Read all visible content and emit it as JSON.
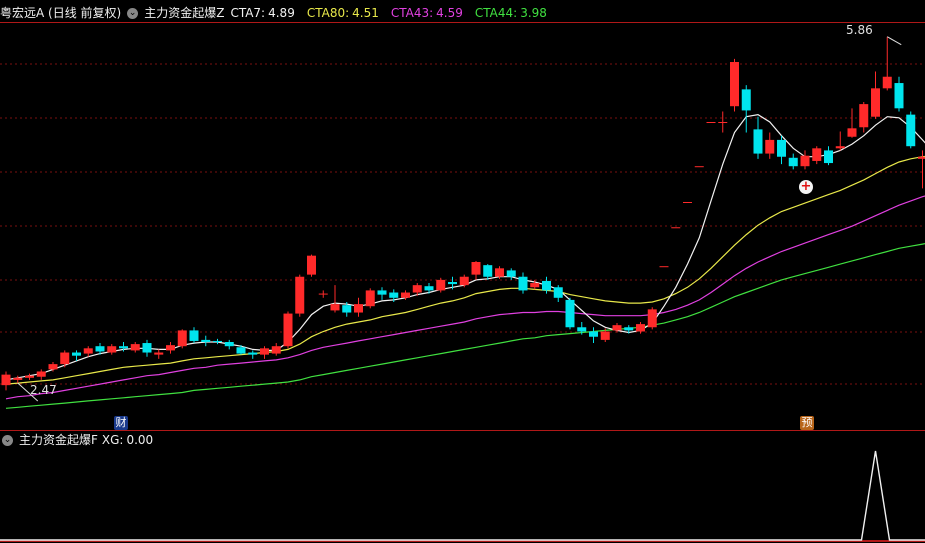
{
  "header": {
    "title": "粤宏远A (日线 前复权)",
    "indicator_name": "主力资金起爆Z",
    "ind1": {
      "label": "CTA7:",
      "value": "4.89",
      "color": "#f2f2f2"
    },
    "ind2": {
      "label": "CTA80:",
      "value": "4.51",
      "color": "#e8e84a"
    },
    "ind3": {
      "label": "CTA43:",
      "value": "4.59",
      "color": "#e040e0"
    },
    "ind4": {
      "label": "CTA44:",
      "value": "3.98",
      "color": "#40e040"
    }
  },
  "sub_header": {
    "indicator_name": "主力资金起爆F",
    "xg_label": "XG:",
    "xg_value": "0.00"
  },
  "markers": {
    "high_price": "5.86",
    "low_price": "2.47",
    "finance_badge": "财",
    "forecast_badge": "预"
  },
  "colors": {
    "up": "#ff2a2a",
    "down": "#00e5ee",
    "grid": "#7a1010",
    "separator": "#b01818"
  },
  "chart_data": {
    "type": "candlestick",
    "y_range": [
      2.2,
      6.0
    ],
    "candles": [
      [
        2.55,
        2.65,
        2.68,
        2.5
      ],
      [
        2.6,
        2.62,
        2.64,
        2.57
      ],
      [
        2.62,
        2.64,
        2.66,
        2.6
      ],
      [
        2.63,
        2.68,
        2.7,
        2.6
      ],
      [
        2.7,
        2.75,
        2.77,
        2.68
      ],
      [
        2.75,
        2.86,
        2.88,
        2.72
      ],
      [
        2.86,
        2.83,
        2.88,
        2.78
      ],
      [
        2.85,
        2.9,
        2.92,
        2.82
      ],
      [
        2.92,
        2.87,
        2.95,
        2.84
      ],
      [
        2.86,
        2.92,
        2.94,
        2.84
      ],
      [
        2.92,
        2.9,
        2.96,
        2.87
      ],
      [
        2.88,
        2.94,
        2.96,
        2.86
      ],
      [
        2.95,
        2.86,
        2.98,
        2.82
      ],
      [
        2.84,
        2.86,
        2.89,
        2.8
      ],
      [
        2.88,
        2.93,
        2.96,
        2.85
      ],
      [
        2.92,
        3.07,
        3.08,
        2.9
      ],
      [
        3.07,
        2.97,
        3.1,
        2.95
      ],
      [
        2.98,
        2.96,
        3.02,
        2.92
      ],
      [
        2.97,
        2.96,
        2.99,
        2.94
      ],
      [
        2.96,
        2.92,
        2.98,
        2.89
      ],
      [
        2.91,
        2.85,
        2.93,
        2.84
      ],
      [
        2.86,
        2.84,
        2.88,
        2.8
      ],
      [
        2.84,
        2.9,
        2.92,
        2.8
      ],
      [
        2.85,
        2.92,
        2.95,
        2.83
      ],
      [
        2.92,
        3.23,
        3.25,
        2.9
      ],
      [
        3.23,
        3.58,
        3.6,
        3.2
      ],
      [
        3.6,
        3.78,
        3.79,
        3.58
      ],
      [
        3.42,
        3.42,
        3.45,
        3.38
      ],
      [
        3.26,
        3.32,
        3.5,
        3.24
      ],
      [
        3.31,
        3.24,
        3.34,
        3.2
      ],
      [
        3.24,
        3.32,
        3.38,
        3.2
      ],
      [
        3.3,
        3.45,
        3.47,
        3.28
      ],
      [
        3.45,
        3.41,
        3.48,
        3.36
      ],
      [
        3.43,
        3.38,
        3.46,
        3.34
      ],
      [
        3.38,
        3.43,
        3.45,
        3.36
      ],
      [
        3.43,
        3.5,
        3.52,
        3.4
      ],
      [
        3.49,
        3.45,
        3.52,
        3.42
      ],
      [
        3.45,
        3.55,
        3.57,
        3.43
      ],
      [
        3.53,
        3.51,
        3.58,
        3.46
      ],
      [
        3.5,
        3.58,
        3.6,
        3.48
      ],
      [
        3.6,
        3.72,
        3.73,
        3.55
      ],
      [
        3.69,
        3.58,
        3.7,
        3.55
      ],
      [
        3.58,
        3.66,
        3.68,
        3.56
      ],
      [
        3.64,
        3.58,
        3.66,
        3.55
      ],
      [
        3.58,
        3.45,
        3.62,
        3.42
      ],
      [
        3.48,
        3.52,
        3.55,
        3.46
      ],
      [
        3.54,
        3.45,
        3.58,
        3.42
      ],
      [
        3.48,
        3.38,
        3.5,
        3.34
      ],
      [
        3.36,
        3.1,
        3.38,
        3.08
      ],
      [
        3.1,
        3.06,
        3.15,
        3.03
      ],
      [
        3.06,
        3.01,
        3.1,
        2.95
      ],
      [
        2.98,
        3.06,
        3.09,
        2.96
      ],
      [
        3.07,
        3.12,
        3.14,
        3.05
      ],
      [
        3.1,
        3.07,
        3.12,
        3.04
      ],
      [
        3.06,
        3.13,
        3.15,
        3.04
      ],
      [
        3.1,
        3.27,
        3.29,
        3.08
      ],
      [
        3.68,
        3.68,
        3.68,
        3.68
      ],
      [
        4.05,
        4.05,
        4.05,
        4.05
      ],
      [
        4.29,
        4.29,
        4.29,
        4.29
      ],
      [
        4.63,
        4.63,
        4.63,
        4.63
      ],
      [
        5.05,
        5.05,
        5.05,
        5.05
      ],
      [
        5.05,
        5.05,
        5.15,
        4.95
      ],
      [
        5.2,
        5.62,
        5.65,
        5.15
      ],
      [
        5.36,
        5.16,
        5.4,
        4.95
      ],
      [
        4.98,
        4.75,
        5.1,
        4.7
      ],
      [
        4.75,
        4.88,
        4.95,
        4.7
      ],
      [
        4.88,
        4.72,
        4.92,
        4.65
      ],
      [
        4.71,
        4.63,
        4.75,
        4.6
      ],
      [
        4.63,
        4.73,
        4.78,
        4.6
      ],
      [
        4.68,
        4.8,
        4.82,
        4.65
      ],
      [
        4.78,
        4.66,
        4.82,
        4.64
      ],
      [
        4.8,
        4.82,
        4.96,
        4.78
      ],
      [
        4.91,
        4.99,
        5.18,
        4.9
      ],
      [
        5.0,
        5.22,
        5.24,
        4.95
      ],
      [
        5.1,
        5.37,
        5.53,
        5.08
      ],
      [
        5.37,
        5.48,
        5.86,
        5.35
      ],
      [
        5.42,
        5.18,
        5.48,
        5.15
      ],
      [
        5.12,
        4.82,
        5.15,
        4.8
      ],
      [
        4.7,
        4.72,
        4.78,
        4.42
      ],
      [
        4.72,
        4.61,
        4.74,
        4.52
      ],
      [
        4.63,
        4.67,
        4.7,
        4.58
      ],
      [
        4.68,
        4.63,
        4.72,
        4.58
      ],
      [
        4.62,
        4.6,
        4.65,
        4.55
      ],
      [
        4.6,
        4.52,
        4.62,
        4.48
      ],
      [
        4.5,
        4.46,
        4.52,
        4.42
      ]
    ],
    "cta7": [
      2.6,
      2.62,
      2.64,
      2.66,
      2.7,
      2.74,
      2.78,
      2.82,
      2.85,
      2.87,
      2.89,
      2.9,
      2.9,
      2.89,
      2.89,
      2.93,
      2.95,
      2.96,
      2.96,
      2.94,
      2.92,
      2.89,
      2.88,
      2.88,
      2.96,
      3.08,
      3.22,
      3.3,
      3.33,
      3.32,
      3.3,
      3.32,
      3.35,
      3.36,
      3.38,
      3.41,
      3.43,
      3.46,
      3.48,
      3.5,
      3.55,
      3.56,
      3.58,
      3.58,
      3.55,
      3.53,
      3.5,
      3.46,
      3.36,
      3.26,
      3.16,
      3.1,
      3.07,
      3.05,
      3.07,
      3.14,
      3.3,
      3.48,
      3.7,
      3.95,
      4.3,
      4.65,
      4.95,
      5.1,
      5.12,
      5.05,
      4.92,
      4.8,
      4.72,
      4.72,
      4.74,
      4.78,
      4.84,
      4.92,
      5.02,
      5.1,
      5.09,
      5.0,
      4.88,
      4.76,
      4.68,
      4.63,
      4.6,
      4.56,
      4.5
    ],
    "cta80": [
      2.56,
      2.57,
      2.58,
      2.59,
      2.6,
      2.62,
      2.64,
      2.66,
      2.68,
      2.7,
      2.72,
      2.73,
      2.74,
      2.75,
      2.76,
      2.78,
      2.8,
      2.81,
      2.82,
      2.83,
      2.84,
      2.85,
      2.86,
      2.87,
      2.89,
      2.94,
      3.01,
      3.06,
      3.1,
      3.13,
      3.15,
      3.17,
      3.2,
      3.22,
      3.24,
      3.27,
      3.3,
      3.33,
      3.35,
      3.38,
      3.42,
      3.44,
      3.46,
      3.47,
      3.47,
      3.46,
      3.45,
      3.44,
      3.41,
      3.39,
      3.37,
      3.35,
      3.34,
      3.33,
      3.33,
      3.34,
      3.37,
      3.42,
      3.48,
      3.56,
      3.66,
      3.77,
      3.88,
      3.98,
      4.07,
      4.14,
      4.2,
      4.24,
      4.28,
      4.32,
      4.36,
      4.4,
      4.45,
      4.5,
      4.56,
      4.62,
      4.67,
      4.7,
      4.72,
      4.73,
      4.74,
      4.73,
      4.72,
      4.7,
      4.68
    ],
    "cta43": [
      2.42,
      2.44,
      2.45,
      2.47,
      2.48,
      2.5,
      2.52,
      2.54,
      2.56,
      2.58,
      2.6,
      2.62,
      2.64,
      2.65,
      2.67,
      2.69,
      2.71,
      2.72,
      2.74,
      2.75,
      2.76,
      2.77,
      2.78,
      2.79,
      2.81,
      2.84,
      2.88,
      2.91,
      2.93,
      2.95,
      2.97,
      2.99,
      3.01,
      3.03,
      3.05,
      3.07,
      3.09,
      3.11,
      3.13,
      3.15,
      3.18,
      3.2,
      3.22,
      3.23,
      3.24,
      3.24,
      3.25,
      3.25,
      3.24,
      3.23,
      3.22,
      3.21,
      3.21,
      3.21,
      3.21,
      3.22,
      3.24,
      3.27,
      3.31,
      3.36,
      3.43,
      3.51,
      3.59,
      3.66,
      3.72,
      3.77,
      3.82,
      3.86,
      3.9,
      3.94,
      3.98,
      4.02,
      4.06,
      4.11,
      4.16,
      4.21,
      4.26,
      4.3,
      4.34,
      4.37,
      4.4,
      4.43,
      4.46,
      4.49,
      4.52
    ],
    "cta44": [
      2.33,
      2.34,
      2.35,
      2.36,
      2.37,
      2.38,
      2.39,
      2.4,
      2.41,
      2.42,
      2.43,
      2.44,
      2.45,
      2.46,
      2.47,
      2.48,
      2.5,
      2.51,
      2.52,
      2.53,
      2.54,
      2.55,
      2.56,
      2.57,
      2.58,
      2.6,
      2.63,
      2.65,
      2.67,
      2.69,
      2.71,
      2.73,
      2.75,
      2.77,
      2.79,
      2.81,
      2.83,
      2.85,
      2.87,
      2.89,
      2.91,
      2.93,
      2.95,
      2.97,
      2.99,
      3.0,
      3.02,
      3.03,
      3.04,
      3.05,
      3.06,
      3.07,
      3.08,
      3.09,
      3.1,
      3.12,
      3.14,
      3.17,
      3.2,
      3.24,
      3.29,
      3.34,
      3.39,
      3.43,
      3.47,
      3.51,
      3.55,
      3.58,
      3.61,
      3.64,
      3.67,
      3.7,
      3.73,
      3.76,
      3.79,
      3.82,
      3.85,
      3.87,
      3.89,
      3.91,
      3.93,
      3.95,
      3.96,
      3.97,
      3.98
    ],
    "xg_signal_index": 74
  }
}
